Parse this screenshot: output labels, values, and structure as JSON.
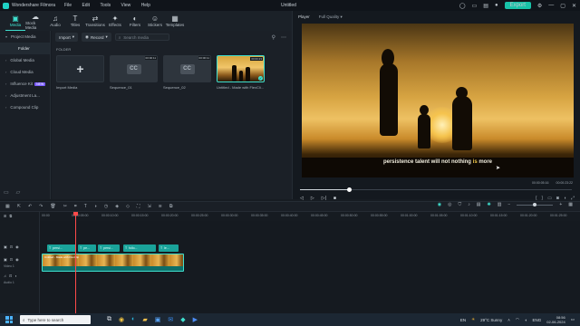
{
  "titlebar": {
    "app_name": "Wondershare Filmora",
    "menus": [
      "File",
      "Edit",
      "Tools",
      "View",
      "Help"
    ],
    "doc_title": "Untitled",
    "export_label": "Export"
  },
  "toolbar": {
    "tabs": [
      {
        "label": "Media",
        "icon": "media-icon",
        "glyph": "▣",
        "active": true
      },
      {
        "label": "Stock Media",
        "icon": "stock-media-icon",
        "glyph": "☁",
        "active": false
      },
      {
        "label": "Audio",
        "icon": "audio-icon",
        "glyph": "♫",
        "active": false
      },
      {
        "label": "Titles",
        "icon": "titles-icon",
        "glyph": "T",
        "active": false
      },
      {
        "label": "Transitions",
        "icon": "transitions-icon",
        "glyph": "⇄",
        "active": false
      },
      {
        "label": "Effects",
        "icon": "effects-icon",
        "glyph": "✦",
        "active": false
      },
      {
        "label": "Filters",
        "icon": "filters-icon",
        "glyph": "◐",
        "active": false
      },
      {
        "label": "Stickers",
        "icon": "stickers-icon",
        "glyph": "☺",
        "active": false
      },
      {
        "label": "Templates",
        "icon": "templates-icon",
        "glyph": "▦",
        "active": false
      }
    ]
  },
  "sidebar": {
    "project_media": "Project Media",
    "folder": "Folder",
    "items": [
      {
        "label": "Global Media"
      },
      {
        "label": "Cloud Media"
      },
      {
        "label": "Influence Kit",
        "badge": "NEW"
      },
      {
        "label": "Adjustment La..."
      },
      {
        "label": "Compound Clip"
      }
    ]
  },
  "media": {
    "import_label": "Import",
    "record_label": "Record",
    "search_placeholder": "Search media",
    "folder_heading": "FOLDER",
    "cards": [
      {
        "name": "Import Media",
        "kind": "import",
        "duration": ""
      },
      {
        "name": "Sequence_01",
        "kind": "sequence",
        "duration": "00:00:11"
      },
      {
        "name": "Sequence_02",
        "kind": "sequence",
        "duration": "00:00:11"
      },
      {
        "name": "Untitled - Made with FlexCli...",
        "kind": "video",
        "duration": "00:00:23"
      }
    ]
  },
  "player": {
    "label": "Player",
    "quality": "Full Quality",
    "caption_before": "persistence talent will not nothing ",
    "caption_highlight": "is",
    "caption_after": " more",
    "current_time": "00:00:05:16",
    "total_time": "00:00:23:22",
    "progress": 0.18
  },
  "timeline": {
    "ruler_ticks": [
      "00:00",
      "00:00:05:00",
      "00:00:10:00",
      "00:00:15:00",
      "00:00:20:00",
      "00:00:25:00",
      "00:00:30:00",
      "00:00:35:00",
      "00:00:40:00",
      "00:00:45:00",
      "00:00:50:00",
      "00:00:55:00",
      "00:01:00:00",
      "00:01:05:00",
      "00:01:10:00",
      "00:01:15:00",
      "00:01:20:00",
      "00:01:25:00"
    ],
    "title_clips": [
      "persi...",
      "pe...",
      "persi...",
      "follo...",
      "le..."
    ],
    "video_clip_label": "Untitled - Made with FlexClip",
    "track_video_label": "Video 1",
    "track_audio_label": "Audio 1"
  },
  "taskbar": {
    "search_placeholder": "Type here to search",
    "weather": "29°C  Sunny",
    "lang": "ENG",
    "time": "08:56",
    "date": "02-06-2024",
    "tray_lang": "EN"
  },
  "colors": {
    "accent": "#3fe0cf",
    "playhead": "#ff4a4a",
    "export": "#18c2a8"
  }
}
